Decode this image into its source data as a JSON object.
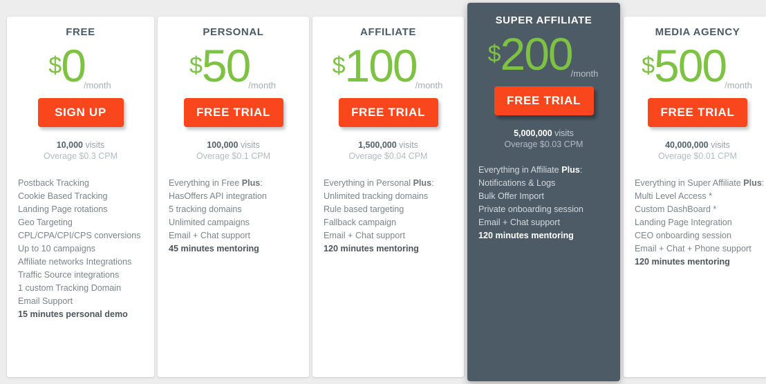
{
  "theme": {
    "page_background": "#ededed",
    "card_background": "#ffffff",
    "featured_background": "#4c5b66",
    "accent_price": "#7dc242",
    "accent_button": "#f9461c",
    "title_color": "#4a5a66"
  },
  "plans": [
    {
      "id": "free",
      "title": "FREE",
      "currency": "$",
      "amount": "0",
      "period": "/month",
      "cta_label": "SIGN UP",
      "cta_icon": "none",
      "visits_count": "10,000",
      "visits_word": "visits",
      "overage": "Overage $0.3 CPM",
      "features": [
        {
          "text": "Postback Tracking",
          "bold": false
        },
        {
          "text": "Cookie Based Tracking",
          "bold": false
        },
        {
          "text": "Landing Page rotations",
          "bold": false
        },
        {
          "text": "Geo Targeting",
          "bold": false
        },
        {
          "text": "CPL/CPA/CPI/CPS conversions",
          "bold": false
        },
        {
          "text": "Up to 10 campaigns",
          "bold": false
        },
        {
          "text": "Affiliate networks Integrations",
          "bold": false
        },
        {
          "text": "Traffic Source integrations",
          "bold": false
        },
        {
          "text": "1 custom Tracking Domain",
          "bold": false
        },
        {
          "text": "Email Support",
          "bold": false
        },
        {
          "text": "15 minutes personal demo",
          "bold": true
        }
      ]
    },
    {
      "id": "personal",
      "title": "PERSONAL",
      "currency": "$",
      "amount": "50",
      "period": "/month",
      "cta_label": "FREE TRIAL",
      "visits_count": "100,000",
      "visits_word": "visits",
      "overage": "Overage $0.1 CPM",
      "features": [
        {
          "text": "Everything in Free Plus:",
          "bold": false,
          "emphasis": "Plus"
        },
        {
          "text": "HasOffers API integration",
          "bold": false
        },
        {
          "text": "5 tracking domains",
          "bold": false
        },
        {
          "text": "Unlimited campaigns",
          "bold": false
        },
        {
          "text": "Email + Chat support",
          "bold": false
        },
        {
          "text": "45 minutes mentoring",
          "bold": true
        }
      ]
    },
    {
      "id": "affiliate",
      "title": "AFFILIATE",
      "currency": "$",
      "amount": "100",
      "period": "/month",
      "cta_label": "FREE TRIAL",
      "visits_count": "1,500,000",
      "visits_word": "visits",
      "overage": "Overage $0.04 CPM",
      "features": [
        {
          "text": "Everything in Personal Plus:",
          "bold": false,
          "emphasis": "Plus"
        },
        {
          "text": "Unlimited tracking domains",
          "bold": false
        },
        {
          "text": "Rule based targeting",
          "bold": false
        },
        {
          "text": "Fallback campaign",
          "bold": false
        },
        {
          "text": "Email + Chat support",
          "bold": false
        },
        {
          "text": "120 minutes mentoring",
          "bold": true
        }
      ]
    },
    {
      "id": "super-affiliate",
      "title": "SUPER AFFILIATE",
      "featured": true,
      "currency": "$",
      "amount": "200",
      "period": "/month",
      "cta_label": "FREE TRIAL",
      "visits_count": "5,000,000",
      "visits_word": "visits",
      "overage": "Overage $0.03 CPM",
      "features": [
        {
          "text": "Everything in Affiliate Plus:",
          "bold": false,
          "emphasis": "Plus"
        },
        {
          "text": "Notifications & Logs",
          "bold": false
        },
        {
          "text": "Bulk Offer Import",
          "bold": false
        },
        {
          "text": "Private onboarding session",
          "bold": false
        },
        {
          "text": "Email + Chat support",
          "bold": false
        },
        {
          "text": "120 minutes mentoring",
          "bold": true
        }
      ]
    },
    {
      "id": "media-agency",
      "title": "MEDIA AGENCY",
      "currency": "$",
      "amount": "500",
      "period": "/month",
      "cta_label": "FREE TRIAL",
      "visits_count": "40,000,000",
      "visits_word": "visits",
      "overage": "Overage $0.01 CPM",
      "features": [
        {
          "text": "Everything in Super Affiliate Plus:",
          "bold": false,
          "emphasis": "Plus"
        },
        {
          "text": "Multi Level Access *",
          "bold": false
        },
        {
          "text": "Custom DashBoard *",
          "bold": false
        },
        {
          "text": "Landing Page Integration",
          "bold": false
        },
        {
          "text": "CEO onboarding session",
          "bold": false
        },
        {
          "text": "Email + Chat + Phone support",
          "bold": false
        },
        {
          "text": "120 minutes mentoring",
          "bold": true
        }
      ]
    }
  ]
}
